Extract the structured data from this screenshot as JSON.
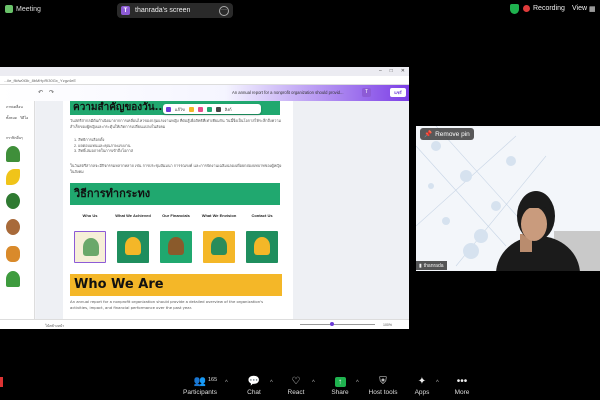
{
  "topbar": {
    "meeting_label": "Meeting",
    "screen_owner_initial": "T",
    "screen_label": "thanrada's screen",
    "more_glyph": "···",
    "recording_label": "Recording",
    "view_label": "View"
  },
  "share": {
    "url_text": "...ile_flkfw0t3b_8bMHpRi30Gx_Yzgz4eE",
    "doc_title": "An annual report for a nonprofit organization should provid...",
    "share_button": "แชร์",
    "owner_initial": "T",
    "heading1": "ความสำคัญของวัน...",
    "intro_paragraph": "วันสตรีสากลมีต้นกำเนิดมาจากการเคลื่อนไหวของกลุ่มแรงงานหญิง ที่ต่อสู้เพื่อสิทธิที่เท่าเทียมกัน วันนี้จึงเป็นโอกาสให้ระลึกถึงความสำเร็จของผู้หญิงและกระตุ้นให้เกิดการเปลี่ยนแปลงในสังคม",
    "list_items": [
      "1.  สิทธิการเลือกตั้ง",
      "2.  ผลตอบแทนและคุณภาพแรงงาน",
      "3.  สิทธิ์เสมอภาคในการเข้าถึงโอกาส"
    ],
    "middle_paragraph": "ในวันสตรีสากลจะมีกิจกรรมหลากหลาย เช่น การประชุมสัมมนา การรณรงค์ และการจัดงานเฉลิมฉลองเพื่อยกย่องบทบาทของผู้หญิงในสังคม",
    "heading2": "วิธีการทำกระทง",
    "columns": [
      {
        "label": "Who Us",
        "color": "#f4b728",
        "shape": "#1f8e5e"
      },
      {
        "label": "What We Achieved",
        "color": "#1f8e5e",
        "shape": "#f4b728"
      },
      {
        "label": "Our Financials",
        "color": "#20a86f",
        "shape": "#8a5a2b"
      },
      {
        "label": "What We Envision",
        "color": "#f4b728",
        "shape": "#2a8c5a"
      },
      {
        "label": "Contact Us",
        "color": "#1f8e5e",
        "shape": "#f4b728"
      }
    ],
    "heading3": "Who We Are",
    "bottom_paragraph": "An annual report for a nonprofit organization should provide a detailed overview of the organization's activities, impact, and financial performance over the past year.",
    "float_toolbar_label": "แก้ไข",
    "float_toolbar_link": "ลิงก์",
    "notes_label": "โน้ตข้างหน้า",
    "zoom_label": "100%",
    "sidebar_labels": [
      "ภาพเคลื่อน",
      "ทั้งหมด",
      "วิดีโอ",
      "กราฟิกอื่นๆ"
    ]
  },
  "video": {
    "remove_pin_label": "Remove pin",
    "participant_name": "thanrada"
  },
  "toolbar": {
    "participants_count": "165",
    "participants_label": "Participants",
    "chat_label": "Chat",
    "react_label": "React",
    "share_label": "Share",
    "host_tools_label": "Host tools",
    "apps_label": "Apps",
    "more_label": "More"
  },
  "colors": {
    "accent_green": "#20a86f",
    "accent_yellow": "#f4b728",
    "recording_red": "#e03b3b",
    "canva_purple": "#7c3fe6"
  }
}
